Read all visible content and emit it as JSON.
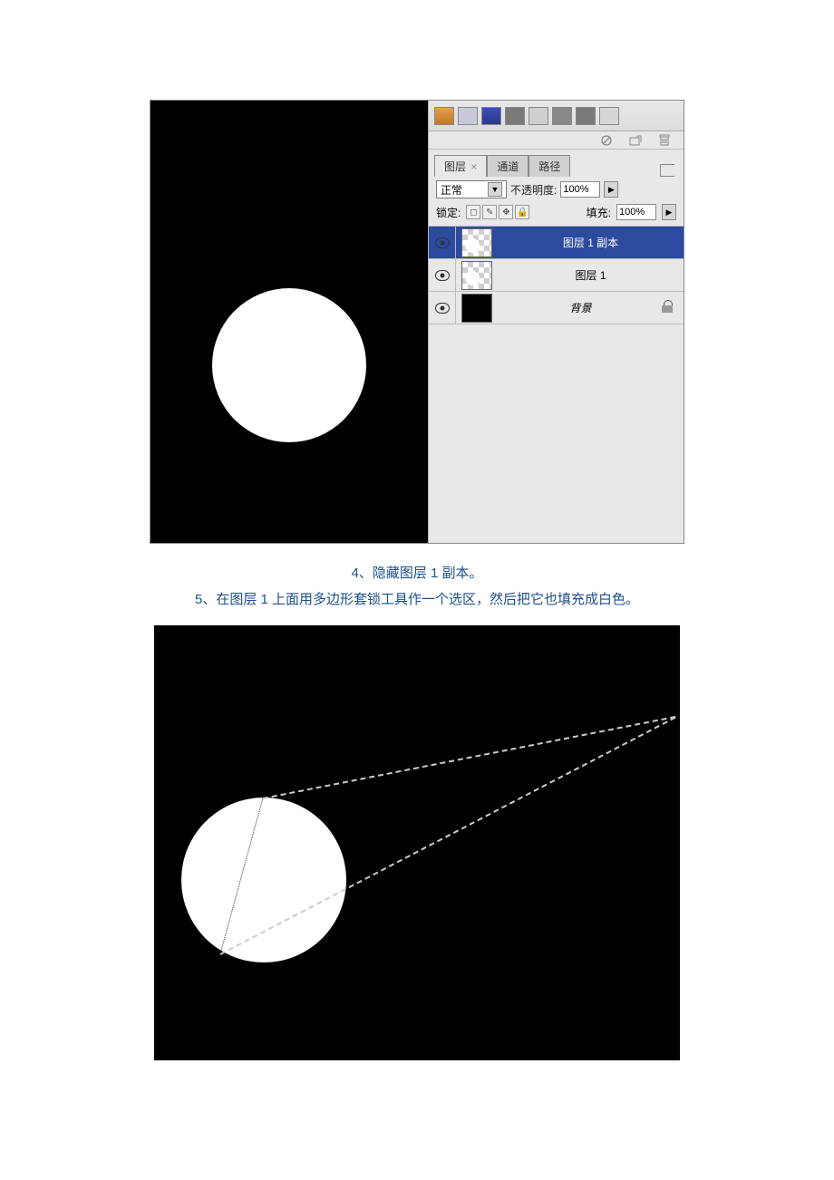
{
  "layers_panel": {
    "tabs": {
      "layers": "图层",
      "channels": "通道",
      "paths": "路径"
    },
    "blend_mode": "正常",
    "opacity_label": "不透明度:",
    "opacity_value": "100%",
    "lock_label": "锁定:",
    "fill_label": "填充:",
    "fill_value": "100%",
    "layers": [
      {
        "name": "图层 1 副本"
      },
      {
        "name": "图层 1"
      },
      {
        "name": "背景"
      }
    ]
  },
  "steps": {
    "s4": "4、隐藏图层 1 副本。",
    "s5": "5、在图层 1 上面用多边形套锁工具作一个选区，然后把它也填充成白色。"
  }
}
